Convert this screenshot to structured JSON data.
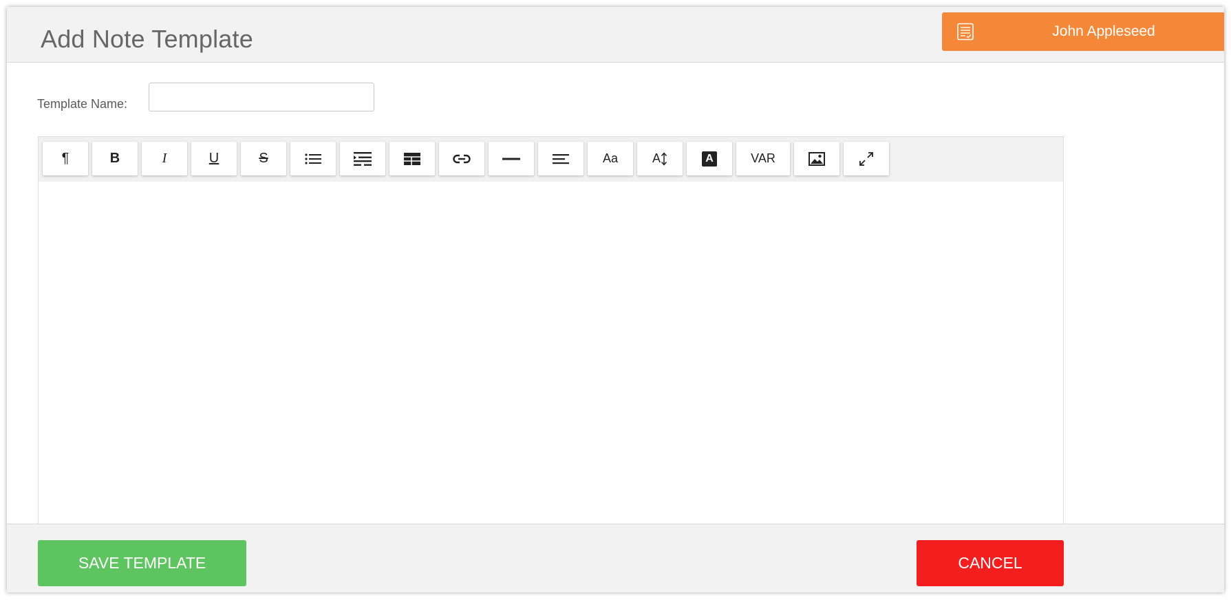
{
  "header": {
    "title": "Add Note Template",
    "user": {
      "name": "John Appleseed",
      "icon": "notes-list-icon",
      "color": "#f58838"
    }
  },
  "form": {
    "template_name_label": "Template Name:",
    "template_name_value": "",
    "template_name_placeholder": ""
  },
  "toolbar": {
    "buttons": [
      {
        "name": "paragraph",
        "icon": "pilcrow-icon",
        "glyph": "¶"
      },
      {
        "name": "bold",
        "icon": "bold-icon",
        "glyph": "B"
      },
      {
        "name": "italic",
        "icon": "italic-icon",
        "glyph": "I"
      },
      {
        "name": "underline",
        "icon": "underline-icon",
        "glyph": "U"
      },
      {
        "name": "strikethrough",
        "icon": "strikethrough-icon",
        "glyph": "S"
      },
      {
        "name": "bullet-list",
        "icon": "bullet-list-icon"
      },
      {
        "name": "indent",
        "icon": "indent-icon"
      },
      {
        "name": "table",
        "icon": "table-icon"
      },
      {
        "name": "link",
        "icon": "link-icon"
      },
      {
        "name": "horizontal-rule",
        "icon": "horizontal-rule-icon"
      },
      {
        "name": "align",
        "icon": "align-left-icon"
      },
      {
        "name": "font-size",
        "icon": "font-size-icon",
        "glyph": "Aa"
      },
      {
        "name": "line-height",
        "icon": "line-height-icon",
        "glyph": "A"
      },
      {
        "name": "text-color",
        "icon": "text-color-icon",
        "glyph": "A"
      },
      {
        "name": "variable",
        "icon": "variable-text",
        "glyph": "VAR"
      },
      {
        "name": "image",
        "icon": "image-icon"
      },
      {
        "name": "fullscreen",
        "icon": "expand-icon"
      }
    ]
  },
  "footer": {
    "save_label": "SAVE TEMPLATE",
    "cancel_label": "CANCEL",
    "save_color": "#5dc460",
    "cancel_color": "#f51e1e"
  }
}
